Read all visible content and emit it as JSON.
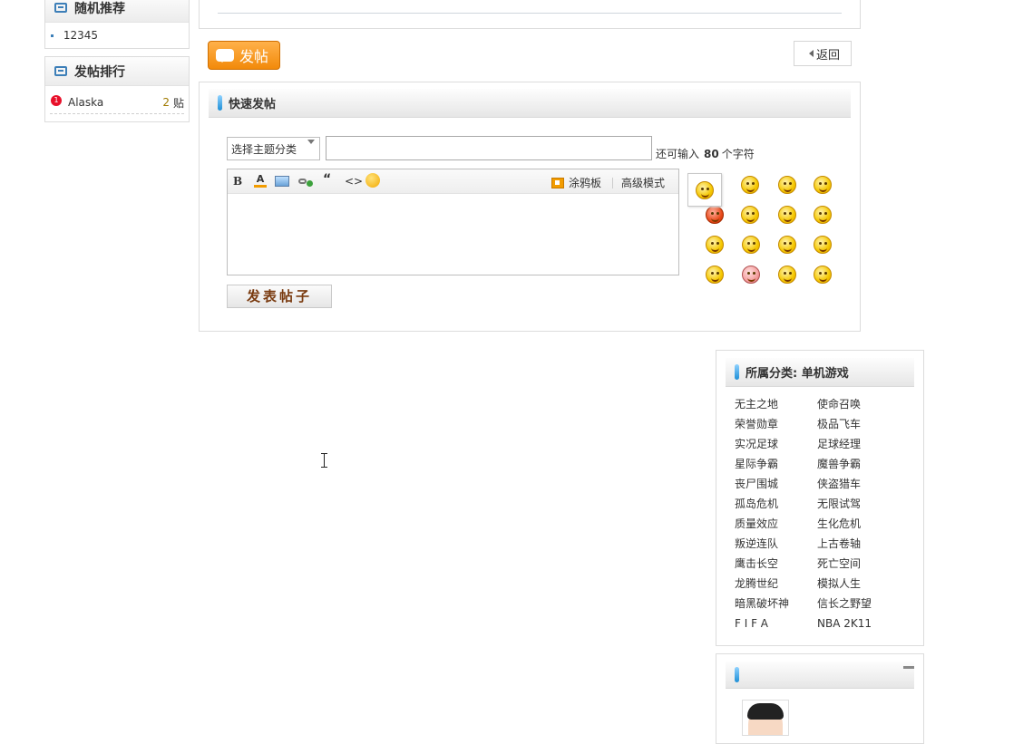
{
  "sidebar": {
    "random": {
      "title": "随机推荐",
      "items": [
        "12345"
      ]
    },
    "ranking": {
      "title": "发帖排行",
      "items": [
        {
          "rank": "1",
          "name": "Alaska",
          "count": "2",
          "unit": "贴"
        }
      ]
    }
  },
  "actions": {
    "post_label": "发帖",
    "back_label": "返回"
  },
  "quick_post": {
    "title": "快速发帖",
    "type_select": "选择主题分类",
    "title_value": "",
    "remain_prefix": "还可输入",
    "remain_count": "80",
    "remain_suffix": "个字符",
    "toolbar": {
      "bold": "B",
      "color": "A",
      "quote": "“",
      "code": "<>",
      "doodle": "涂鸦板",
      "advanced": "高级模式"
    },
    "submit_label": "发表帖子"
  },
  "category": {
    "title": "所属分类: 单机游戏",
    "items": [
      "无主之地",
      "使命召唤",
      "荣誉勋章",
      "极品飞车",
      "实况足球",
      "足球经理",
      "星际争霸",
      "魔兽争霸",
      "丧尸围城",
      "侠盗猎车",
      "孤岛危机",
      "无限试驾",
      "质量效应",
      "生化危机",
      "叛逆连队",
      "上古卷轴",
      "鹰击长空",
      "死亡空间",
      "龙腾世纪",
      "模拟人生",
      "暗黑破坏神",
      "信长之野望",
      "F I F A",
      "NBA 2K11"
    ]
  },
  "colors": {
    "accent_blue": "#1e8fd6",
    "post_orange": "#f28a0a",
    "rank_red": "#e8102a"
  },
  "icons": [
    "list-icon",
    "speech-bubble-icon",
    "back-arrow-icon",
    "smiley-icon",
    "doodle-board-icon"
  ]
}
